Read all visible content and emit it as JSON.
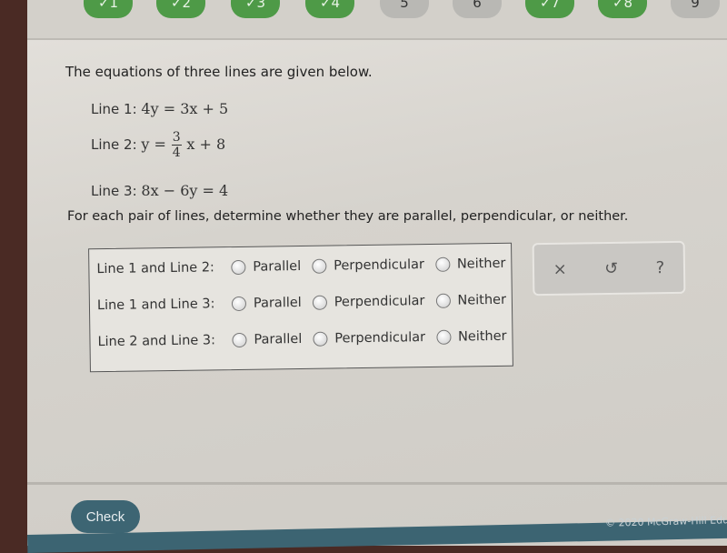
{
  "question_nav": [
    {
      "label": "✓1",
      "status": "done"
    },
    {
      "label": "✓2",
      "status": "done"
    },
    {
      "label": "✓3",
      "status": "done"
    },
    {
      "label": "✓4",
      "status": "done"
    },
    {
      "label": "5",
      "status": "todo"
    },
    {
      "label": "6",
      "status": "todo"
    },
    {
      "label": "✓7",
      "status": "done"
    },
    {
      "label": "✓8",
      "status": "done"
    },
    {
      "label": "9",
      "status": "todo"
    }
  ],
  "problem": {
    "intro": "The equations of three lines are given below.",
    "lines": [
      {
        "label": "Line 1:",
        "equation": "4y = 3x + 5"
      },
      {
        "label": "Line 2:",
        "equation_prefix": "y =",
        "fraction_num": "3",
        "fraction_den": "4",
        "equation_suffix": "x + 8"
      },
      {
        "label": "Line 3:",
        "equation": "8x − 6y = 4"
      }
    ],
    "prompt": "For each pair of lines, determine whether they are parallel, perpendicular, or neither."
  },
  "answers": {
    "options": [
      "Parallel",
      "Perpendicular",
      "Neither"
    ],
    "rows": [
      {
        "label": "Line 1 and Line 2:",
        "selected": null
      },
      {
        "label": "Line 1 and Line 3:",
        "selected": null
      },
      {
        "label": "Line 2 and Line 3:",
        "selected": null
      }
    ]
  },
  "tools": {
    "clear": "×",
    "undo": "↺",
    "help": "?"
  },
  "footer": {
    "check_label": "Check",
    "copyright": "© 2020 McGraw-Hill Edu"
  },
  "colors": {
    "done": "#4e9a47",
    "todo": "#b9b8b4",
    "primary": "#3d6573"
  }
}
